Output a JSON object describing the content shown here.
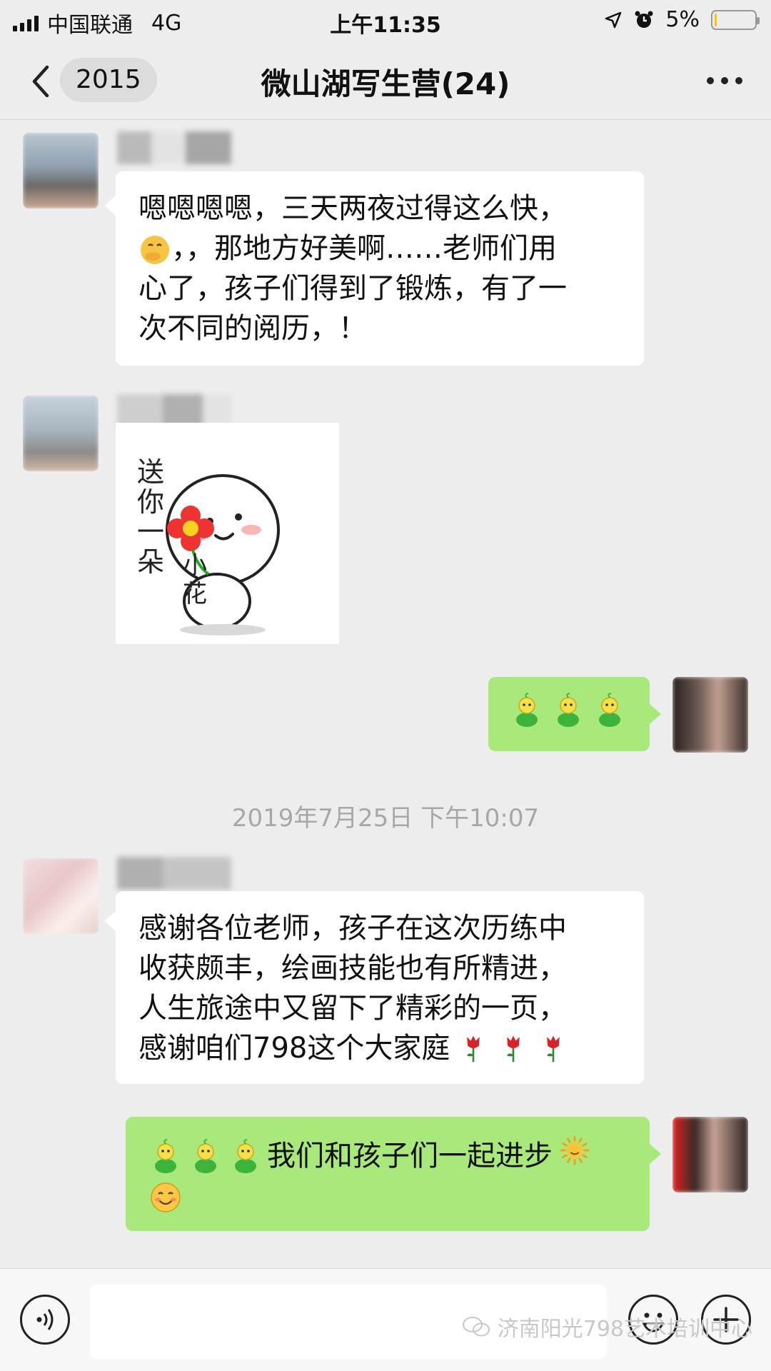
{
  "status_bar": {
    "carrier": "中国联通",
    "network": "4G",
    "time": "上午11:35",
    "battery_percent": "5%",
    "battery_level": 0.05,
    "battery_color": "#f5c518"
  },
  "nav": {
    "back_count": "2015",
    "title": "微山湖写生营(24)",
    "back_icon": "chevron-left-icon",
    "more_icon": "more-dots-icon"
  },
  "messages": [
    {
      "side": "left",
      "type": "text",
      "text_lines": [
        "嗯嗯嗯嗯，三天两夜过得这么快，",
        "🤭，，那地方好美啊……老师们用",
        "心了，孩子们得到了锻炼，有了一",
        "次不同的阅历，！"
      ]
    },
    {
      "side": "left",
      "type": "sticker",
      "sticker_text": [
        "送你一朵",
        "小花"
      ]
    },
    {
      "side": "right",
      "type": "emoji",
      "emojis": [
        "sprout-person-emoji",
        "sprout-person-emoji",
        "sprout-person-emoji"
      ]
    },
    {
      "side": "left",
      "type": "text",
      "text_lines": [
        "感谢各位老师，孩子在这次历练中",
        "收获颇丰，绘画技能也有所精进，",
        "人生旅途中又留下了精彩的一页，",
        "感谢咱们798这个大家庭"
      ],
      "trailing_emojis": [
        "rose-emoji",
        "rose-emoji",
        "rose-emoji"
      ]
    },
    {
      "side": "right",
      "type": "text",
      "text": "我们和孩子们一起进步",
      "leading_emojis": [
        "sprout-person-emoji",
        "sprout-person-emoji",
        "sprout-person-emoji"
      ],
      "trailing_emojis": [
        "sun-emoji",
        "smile-emoji"
      ]
    }
  ],
  "timestamp": "2019年7月25日 下午10:07",
  "input_bar": {
    "voice_icon": "voice-icon",
    "emoji_icon": "emoji-face-icon",
    "plus_icon": "plus-icon"
  },
  "watermark": "济南阳光798艺术培训中心",
  "colors": {
    "background": "#ededed",
    "bubble_white": "#ffffff",
    "bubble_green": "#a9e97c",
    "timestamp": "#a7a7a7"
  }
}
